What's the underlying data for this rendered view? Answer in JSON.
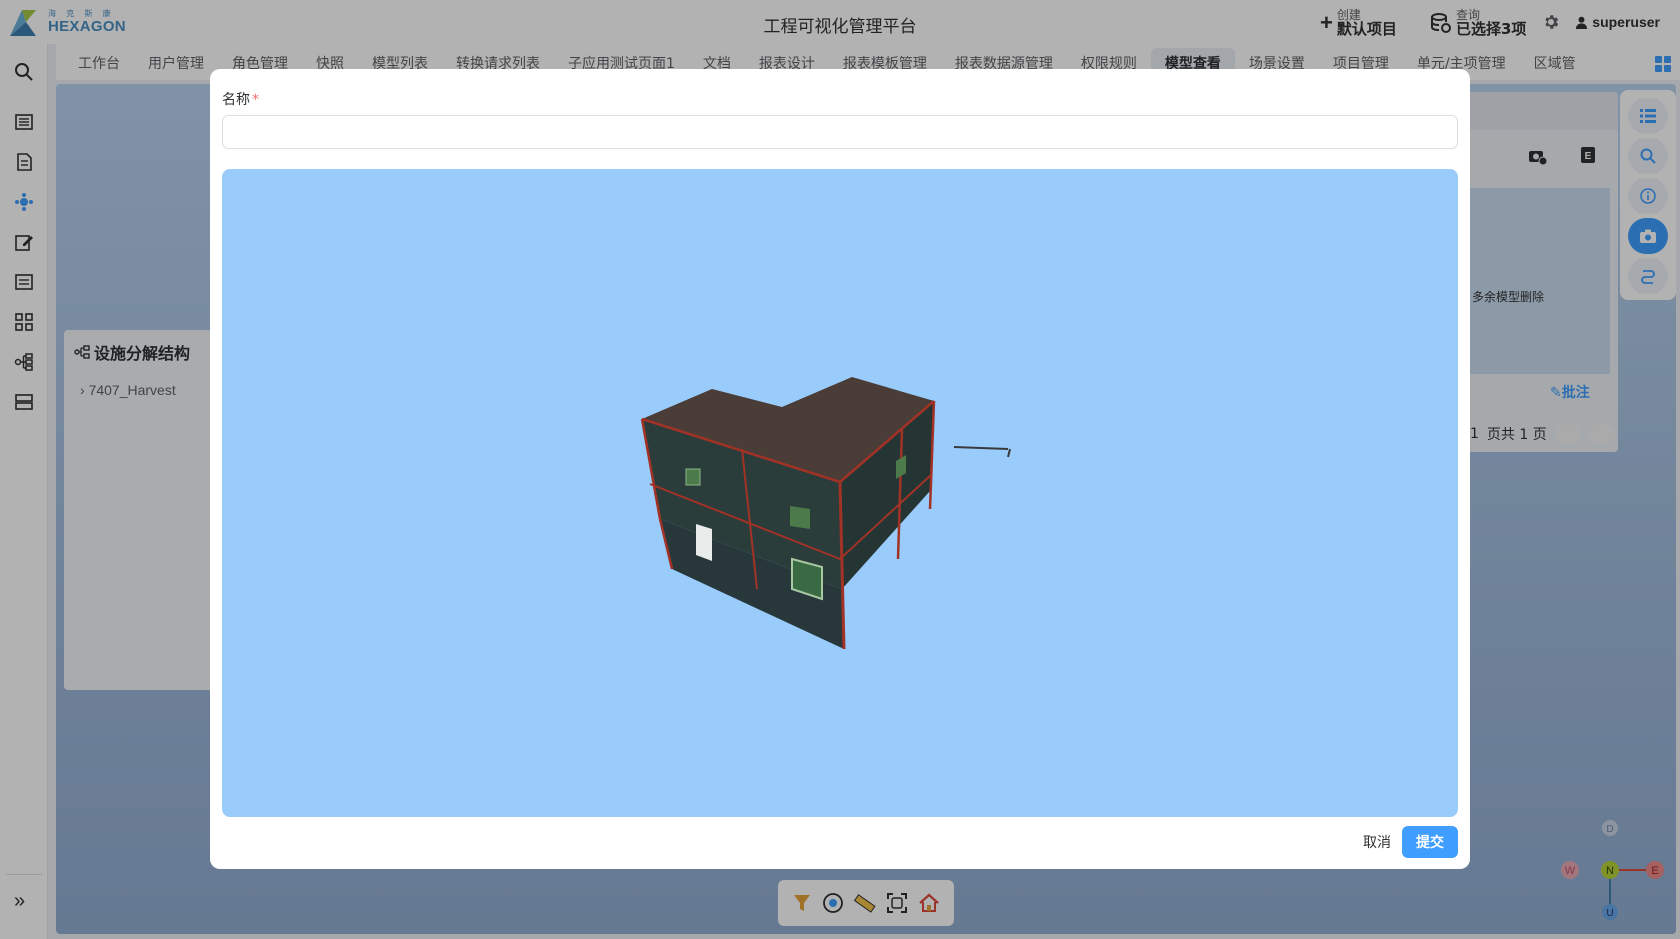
{
  "header": {
    "logo_text": "HEXAGON",
    "logo_sub": "海 克 斯 康",
    "app_title": "工程可视化管理平台",
    "create_small": "创建",
    "create_big": "默认项目",
    "query_small": "查询",
    "query_big": "已选择3项",
    "user": "superuser"
  },
  "tabs": [
    {
      "label": "工作台"
    },
    {
      "label": "用户管理"
    },
    {
      "label": "角色管理"
    },
    {
      "label": "快照"
    },
    {
      "label": "模型列表"
    },
    {
      "label": "转换请求列表"
    },
    {
      "label": "子应用测试页面1"
    },
    {
      "label": "文档"
    },
    {
      "label": "报表设计"
    },
    {
      "label": "报表模板管理"
    },
    {
      "label": "报表数据源管理"
    },
    {
      "label": "权限规则"
    },
    {
      "label": "模型查看"
    },
    {
      "label": "场景设置"
    },
    {
      "label": "项目管理"
    },
    {
      "label": "单元/主项管理"
    },
    {
      "label": "区域管"
    }
  ],
  "left_panel": {
    "title": "设施分解结构",
    "tree_item": "7407_Harvest"
  },
  "right_panel": {
    "caption": "多余模型删除",
    "note": "批注",
    "page_num": "1",
    "page_total": "页共 1 页"
  },
  "compass": {
    "D": "D",
    "W": "W",
    "N": "N",
    "E": "E",
    "U": "U"
  },
  "dialog": {
    "name_label": "名称",
    "required_mark": "*",
    "name_value": "",
    "cancel_label": "取消",
    "submit_label": "提交"
  },
  "colors": {
    "accent": "#409eff",
    "viewer_bg": "#99cbfb",
    "required": "#f56c6c"
  }
}
